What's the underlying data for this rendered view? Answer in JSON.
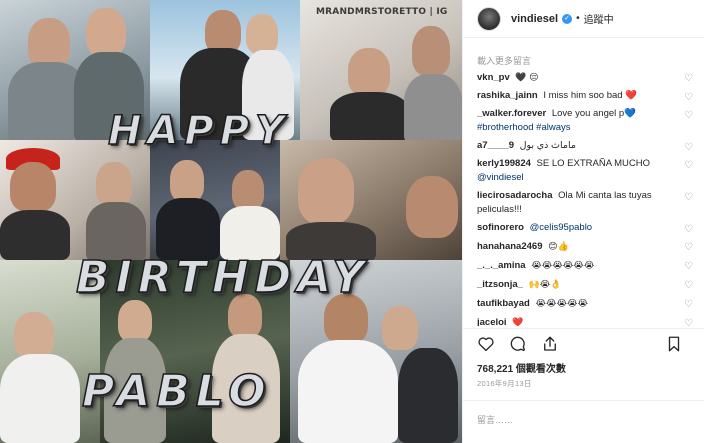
{
  "image": {
    "watermark": "MRANDMRSTORETTO | IG",
    "words": [
      "HAPPY",
      "BIRTHDAY",
      "PABLO"
    ]
  },
  "header": {
    "username": "vindiesel",
    "separator": "•",
    "follow_state": "追蹤中",
    "verified_icon": "verified-check-icon"
  },
  "comments": {
    "load_more": "載入更多留言",
    "items": [
      {
        "user": "vkn_pv",
        "text": "🖤 😔"
      },
      {
        "user": "rashika_jainn",
        "text": "I miss him soo bad ❤️"
      },
      {
        "user": "_walker.forever",
        "text": "Love you angel p💙",
        "tags": "#brotherhood #always"
      },
      {
        "user": "a7____9",
        "text": "ماماث ذي بول"
      },
      {
        "user": "kerly199824",
        "text": "SE LO EXTRAÑA MUCHO",
        "tags": "@vindiesel"
      },
      {
        "user": "liecirosadarocha",
        "text": "Ola Mi canta las tuyas peliculas!!!"
      },
      {
        "user": "sofinorero",
        "text": "",
        "tags": "@celis95pablo"
      },
      {
        "user": "hanahana2469",
        "text": "😊👍"
      },
      {
        "user": "_._._amina",
        "text": "😭😭😭😭😭😭"
      },
      {
        "user": "_itzsonja_",
        "text": "🙌😭👌"
      },
      {
        "user": "taufikbayad",
        "text": "😭😭😭😭😭"
      },
      {
        "user": "jaceloi",
        "text": "❤️"
      }
    ]
  },
  "actions": {
    "like_icon": "heart-icon",
    "comment_icon": "comment-icon",
    "share_icon": "share-icon",
    "save_icon": "bookmark-icon"
  },
  "stats": {
    "views": "768,221 個觀看次數",
    "date": "2016年9月13日"
  },
  "composer": {
    "placeholder": "留言……"
  }
}
